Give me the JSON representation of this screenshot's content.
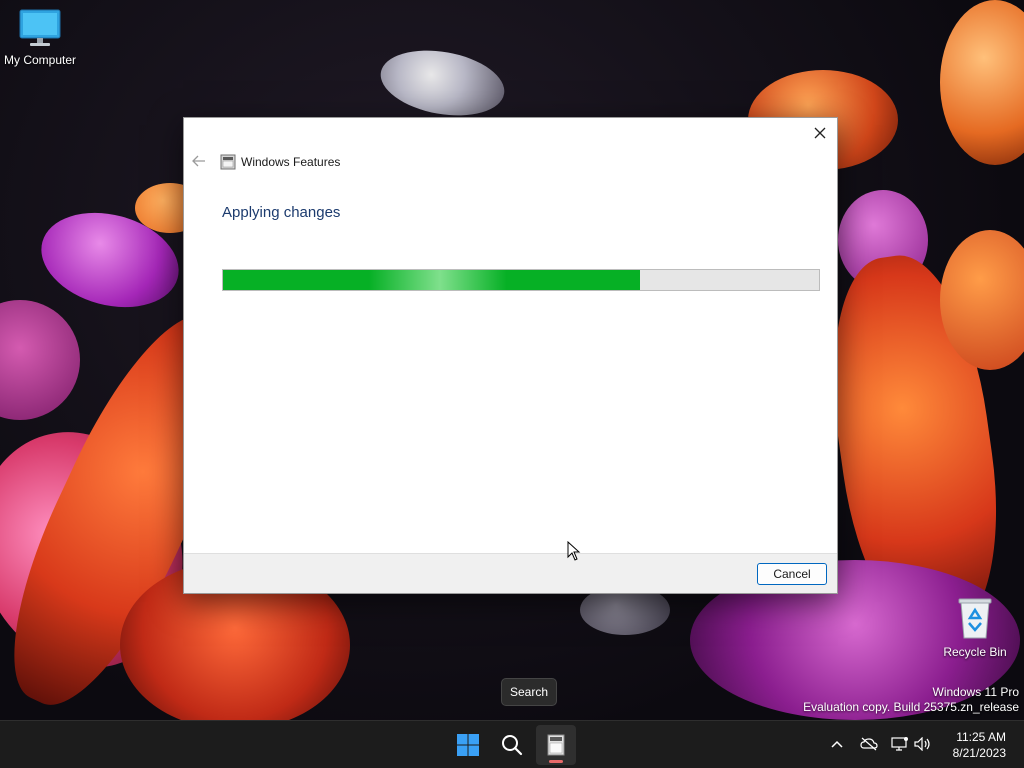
{
  "desktop": {
    "icons": [
      {
        "label": "My Computer",
        "icon": "monitor-icon"
      },
      {
        "label": "Recycle Bin",
        "icon": "recycle-bin-icon"
      }
    ]
  },
  "dialog": {
    "title": "Windows Features",
    "heading": "Applying changes",
    "progress": 0.7,
    "progress_color": "#06b025",
    "cancel_label": "Cancel",
    "icons": {
      "back": "back-arrow-icon",
      "close": "close-icon",
      "app": "windows-features-icon"
    }
  },
  "tooltip": {
    "text": "Search"
  },
  "watermark": {
    "line1": "Windows 11 Pro",
    "line2": "Evaluation copy. Build 25375.zn_release"
  },
  "taskbar": {
    "buttons": [
      {
        "name": "start",
        "icon": "windows-logo-icon"
      },
      {
        "name": "search",
        "icon": "search-icon"
      },
      {
        "name": "windows-features",
        "icon": "windows-features-icon",
        "active": true
      }
    ],
    "tray": [
      "chevron-up-icon",
      "onedrive-icon",
      "network-icon",
      "volume-icon"
    ],
    "clock": {
      "time": "11:25 AM",
      "date": "8/21/2023"
    }
  },
  "colors": {
    "accent": "#0067c0",
    "heading": "#1c3b6e",
    "taskbar": "#1c1c1c"
  }
}
